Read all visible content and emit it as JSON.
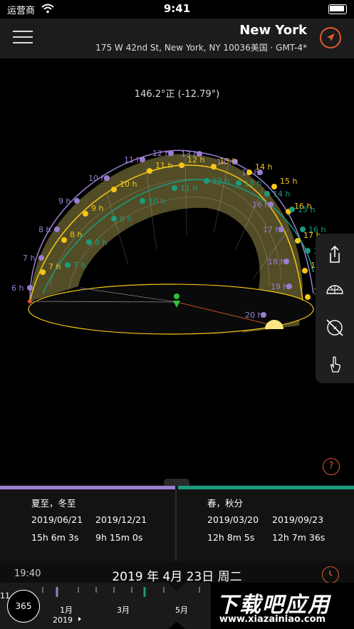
{
  "status_bar": {
    "carrier": "运营商",
    "time": "9:41"
  },
  "header": {
    "city": "New York",
    "address": "175 W 42nd St, New York, NY 10036美国 · GMT-4*"
  },
  "sun_readout": "146.2°正 (-12.79°)",
  "hour_labels": {
    "purple": [
      "6 h",
      "7 h",
      "8 h",
      "9 h",
      "10 h",
      "11 h",
      "12 h",
      "13 h",
      "14 h",
      "15 h",
      "16 h",
      "17 h",
      "18 h",
      "19 h",
      "20 h"
    ],
    "yellow": [
      "7 h",
      "8 h",
      "9 h",
      "10 h",
      "11 h",
      "12 h",
      "13 h",
      "14 h",
      "15 h",
      "16 h",
      "17 h",
      "18 h",
      "19 h"
    ],
    "green": [
      "7 h",
      "8 h",
      "9 h",
      "10 h",
      "11 h",
      "12 h",
      "13 h",
      "14 h",
      "15 h",
      "16 h",
      "17 h"
    ]
  },
  "panel": {
    "left": {
      "title": "夏至，冬至",
      "date1": "2019/06/21",
      "date2": "2019/12/21",
      "dur1": "15h 6m 3s",
      "dur2": "9h 15m 0s"
    },
    "right": {
      "title": "春，秋分",
      "date1": "2019/03/20",
      "date2": "2019/09/23",
      "dur1": "12h 8m 5s",
      "dur2": "12h 7m 36s"
    }
  },
  "bottom": {
    "local_time": "19:40",
    "date": "2019 年 4月 23日 周二",
    "year_button": "365",
    "year": "2019",
    "edge_label": "11",
    "months": [
      "1月",
      "3月",
      "5月"
    ]
  },
  "watermark": {
    "text": "下载吧应用",
    "url": "www.xiazainiao.com"
  },
  "colors": {
    "accent": "#e05a2a",
    "summer": "#9a7fd1",
    "equinox": "#1a9c7d",
    "today": "#f5c518"
  },
  "icons": [
    "wifi-icon",
    "battery-icon",
    "menu-icon",
    "location-arrow-icon",
    "share-icon",
    "globe-icon",
    "compass-off-icon",
    "hand-pointer-icon",
    "help-icon",
    "clock-icon"
  ]
}
